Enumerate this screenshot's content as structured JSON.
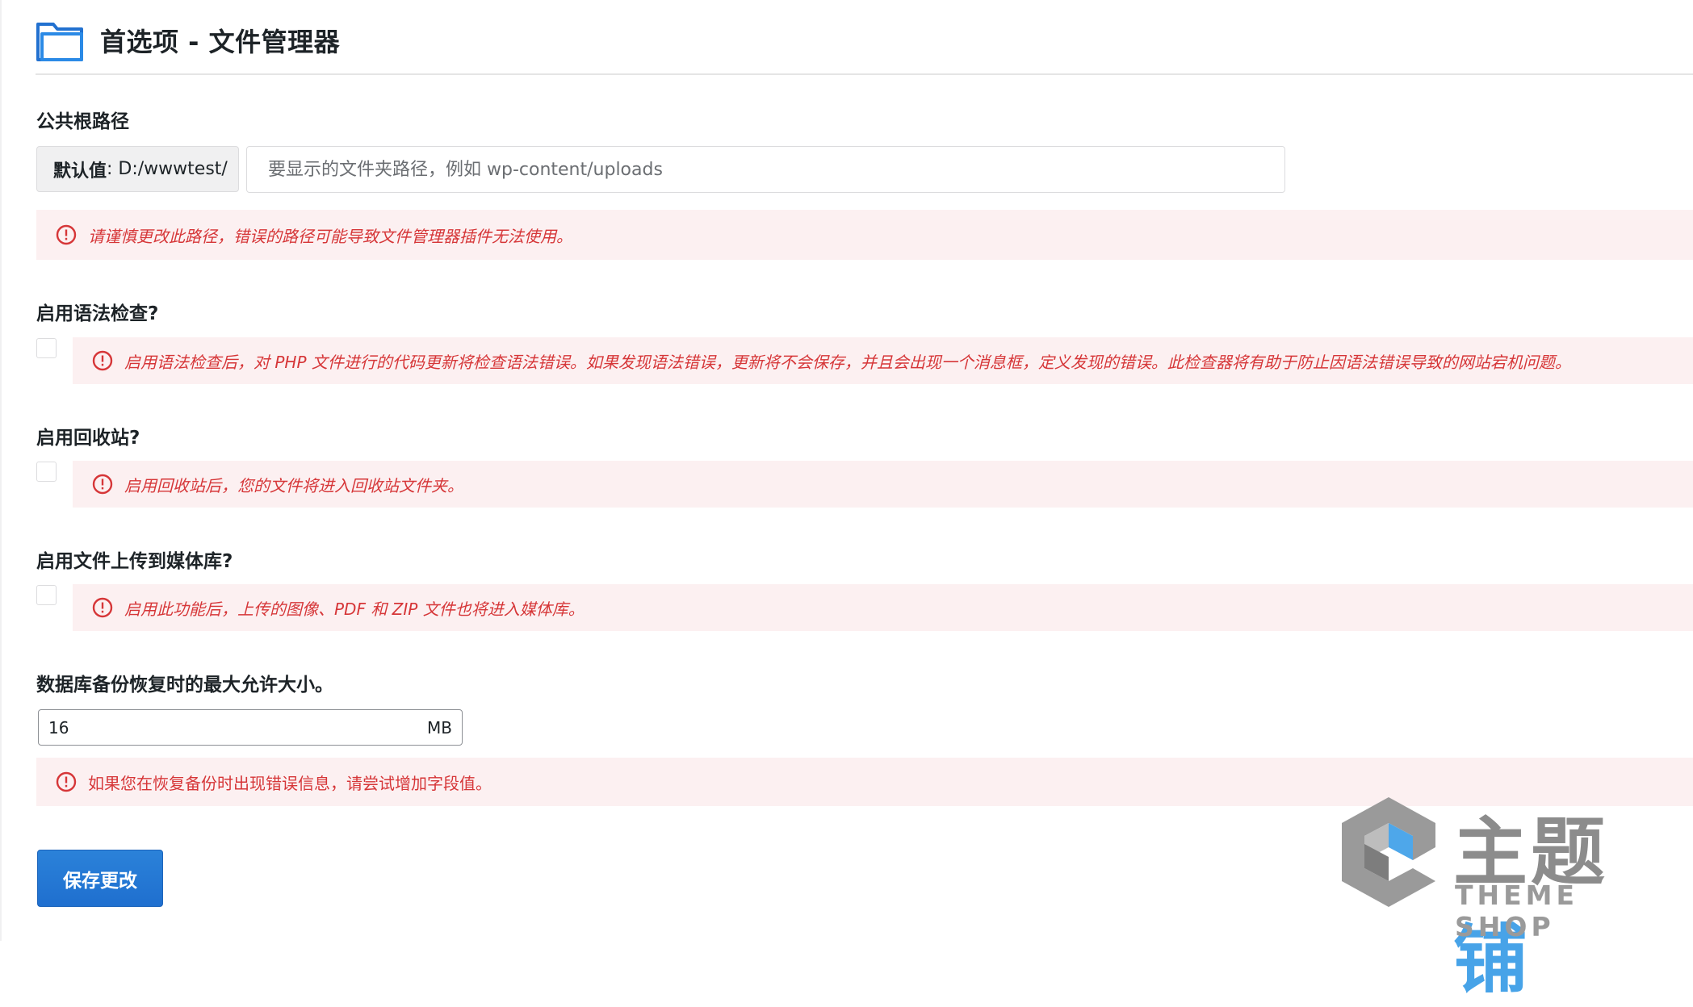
{
  "header": {
    "title": "首选项 - 文件管理器",
    "icon": "folder-icon"
  },
  "public_root": {
    "label": "公共根路径",
    "default_key": "默认值",
    "default_value": ": D:/wwwtest/",
    "input_value": "",
    "input_placeholder": "要显示的文件夹路径，例如 wp-content/uploads",
    "notice": "请谨慎更改此路径，错误的路径可能导致文件管理器插件无法使用。"
  },
  "syntax_check": {
    "label": "启用语法检查?",
    "checked": false,
    "notice": "启用语法检查后，对 PHP 文件进行的代码更新将检查语法错误。如果发现语法错误，更新将不会保存，并且会出现一个消息框，定义发现的错误。此检查器将有助于防止因语法错误导致的网站宕机问题。"
  },
  "trash": {
    "label": "启用回收站?",
    "checked": false,
    "notice": "启用回收站后，您的文件将进入回收站文件夹。"
  },
  "media_upload": {
    "label": "启用文件上传到媒体库?",
    "checked": false,
    "notice": "启用此功能后，上传的图像、PDF 和 ZIP 文件也将进入媒体库。"
  },
  "db_restore": {
    "label": "数据库备份恢复时的最大允许大小。",
    "value": "16",
    "unit": "MB",
    "notice": "如果您在恢复备份时出现错误信息，请尝试增加字段值。"
  },
  "save_button": "保存更改",
  "watermark": {
    "cn": "主题铺",
    "cn_gray": "主题",
    "cn_blue": "铺",
    "en": "THEME SHOP"
  },
  "colors": {
    "accent": "#2271b1",
    "notice_bg": "#fcf0f1",
    "notice_text": "#d63638"
  }
}
